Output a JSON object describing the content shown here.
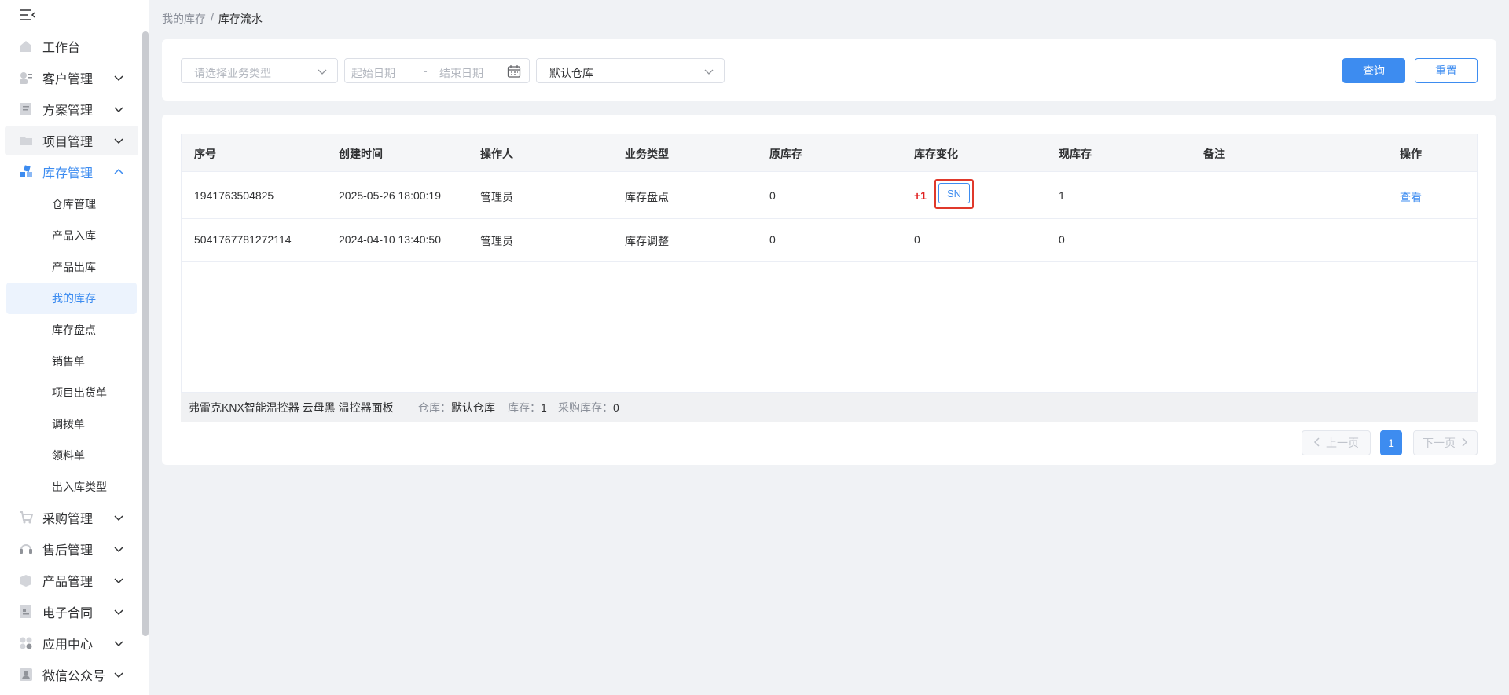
{
  "sidebar": {
    "groups_top": [
      {
        "label": "工作台",
        "icon": "home-icon"
      },
      {
        "label": "客户管理",
        "icon": "customer-icon"
      },
      {
        "label": "方案管理",
        "icon": "document-icon"
      },
      {
        "label": "项目管理",
        "icon": "folder-icon"
      },
      {
        "label": "库存管理",
        "icon": "inventory-icon"
      }
    ],
    "sub_items": [
      {
        "label": "仓库管理"
      },
      {
        "label": "产品入库"
      },
      {
        "label": "产品出库"
      },
      {
        "label": "我的库存"
      },
      {
        "label": "库存盘点"
      },
      {
        "label": "销售单"
      },
      {
        "label": "项目出货单"
      },
      {
        "label": "调拨单"
      },
      {
        "label": "领料单"
      },
      {
        "label": "出入库类型"
      }
    ],
    "groups_bottom": [
      {
        "label": "采购管理",
        "icon": "cart-icon"
      },
      {
        "label": "售后管理",
        "icon": "headset-icon"
      },
      {
        "label": "产品管理",
        "icon": "box-icon"
      },
      {
        "label": "电子合同",
        "icon": "contract-icon"
      },
      {
        "label": "应用中心",
        "icon": "apps-icon"
      },
      {
        "label": "微信公众号",
        "icon": "wechat-user-icon"
      }
    ]
  },
  "breadcrumb": {
    "parent": "我的库存",
    "separator": "/",
    "current": "库存流水"
  },
  "filters": {
    "business_type_placeholder": "请选择业务类型",
    "start_date_placeholder": "起始日期",
    "date_separator": "-",
    "end_date_placeholder": "结束日期",
    "warehouse_value": "默认仓库",
    "query_label": "查询",
    "reset_label": "重置"
  },
  "table": {
    "headers": [
      "序号",
      "创建时间",
      "操作人",
      "业务类型",
      "原库存",
      "库存变化",
      "现库存",
      "备注",
      "操作"
    ],
    "rows": [
      {
        "id": "1941763504825",
        "created": "2025-05-26 18:00:19",
        "operator": "管理员",
        "type": "库存盘点",
        "before": "0",
        "change": "+1",
        "change_tag": "SN",
        "after": "1",
        "note": "",
        "action": "查看"
      },
      {
        "id": "5041767781272114",
        "created": "2024-04-10 13:40:50",
        "operator": "管理员",
        "type": "库存调整",
        "before": "0",
        "change": "0",
        "change_tag": "",
        "after": "0",
        "note": "",
        "action": ""
      }
    ]
  },
  "summary": {
    "product": "弗雷克KNX智能温控器 云母黑  温控器面板",
    "warehouse_label": "仓库：",
    "warehouse_value": "默认仓库",
    "stock_label": "库存：",
    "stock_value": "1",
    "purchase_stock_label": "采购库存：",
    "purchase_stock_value": "0"
  },
  "pagination": {
    "prev": "上一页",
    "current": "1",
    "next": "下一页"
  },
  "colors": {
    "primary": "#3d8cf0",
    "increase": "#e02020",
    "highlight_border": "#e0392b"
  }
}
